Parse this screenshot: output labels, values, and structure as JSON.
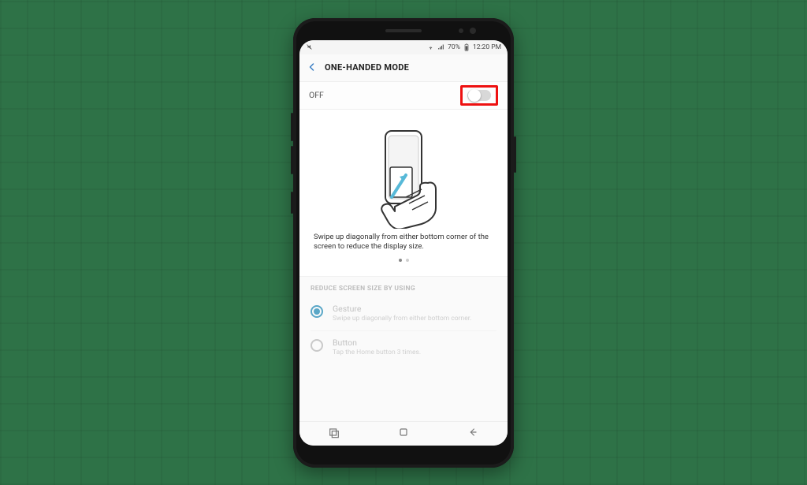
{
  "statusbar": {
    "battery_pct": "70%",
    "time": "12:20 PM"
  },
  "page": {
    "title": "ONE-HANDED MODE"
  },
  "toggle": {
    "state_label": "OFF",
    "on": false
  },
  "illustration": {
    "caption": "Swipe up diagonally from either bottom corner of the screen to reduce the display size.",
    "pager_count": 2,
    "pager_active": 0
  },
  "section": {
    "title": "REDUCE SCREEN SIZE BY USING",
    "options": [
      {
        "title": "Gesture",
        "subtitle": "Swipe up diagonally from either bottom corner.",
        "selected": true
      },
      {
        "title": "Button",
        "subtitle": "Tap the Home button 3 times.",
        "selected": false
      }
    ]
  },
  "annotation": {
    "highlight_toggle": true
  }
}
